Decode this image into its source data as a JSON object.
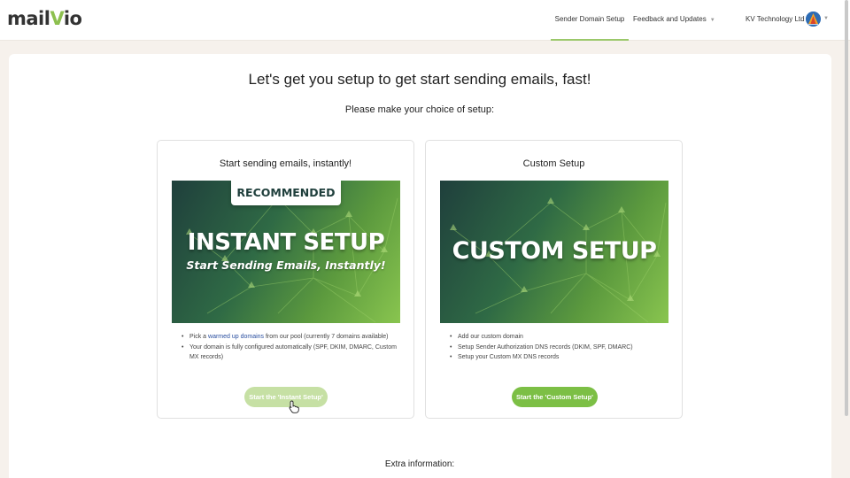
{
  "brand": {
    "logo_prefix": "mail",
    "logo_v": "V",
    "logo_suffix": "io"
  },
  "nav": {
    "sender_domain_setup": "Sender Domain Setup",
    "feedback_and_updates": "Feedback and Updates",
    "caret": "▼"
  },
  "account": {
    "company": "KV Technology Ltd",
    "caret": "▼"
  },
  "page": {
    "headline": "Let's get you setup to get start sending emails, fast!",
    "subline": "Please make your choice of setup:",
    "extra_information": "Extra information:"
  },
  "instant": {
    "title": "Start sending emails, instantly!",
    "badge": "RECOMMENDED",
    "banner_title": "INSTANT SETUP",
    "banner_subtitle": "Start Sending Emails, Instantly!",
    "feature1_pre": "Pick a ",
    "feature1_link": "warmed up domains",
    "feature1_post": " from our pool (currently 7 domains available)",
    "feature2": "Your domain is fully configured automatically (SPF, DKIM, DMARC, Custom MX records)",
    "button": "Start the 'Instant Setup'"
  },
  "custom": {
    "title": "Custom Setup",
    "banner_title": "CUSTOM SETUP",
    "features": [
      "Add our custom domain",
      "Setup Sender Authorization DNS records (DKIM, SPF, DMARC)",
      "Setup your Custom MX DNS records"
    ],
    "button": "Start the 'Custom Setup'"
  },
  "colors": {
    "accent_green": "#7cbf45",
    "accent_green_disabled": "#c6e0a4",
    "banner_dark": "#1f3f3c",
    "link_blue": "#2a4fa0"
  },
  "icons": {
    "avatar": "company-logo-avatar",
    "cursor": "hand-pointer-icon"
  }
}
